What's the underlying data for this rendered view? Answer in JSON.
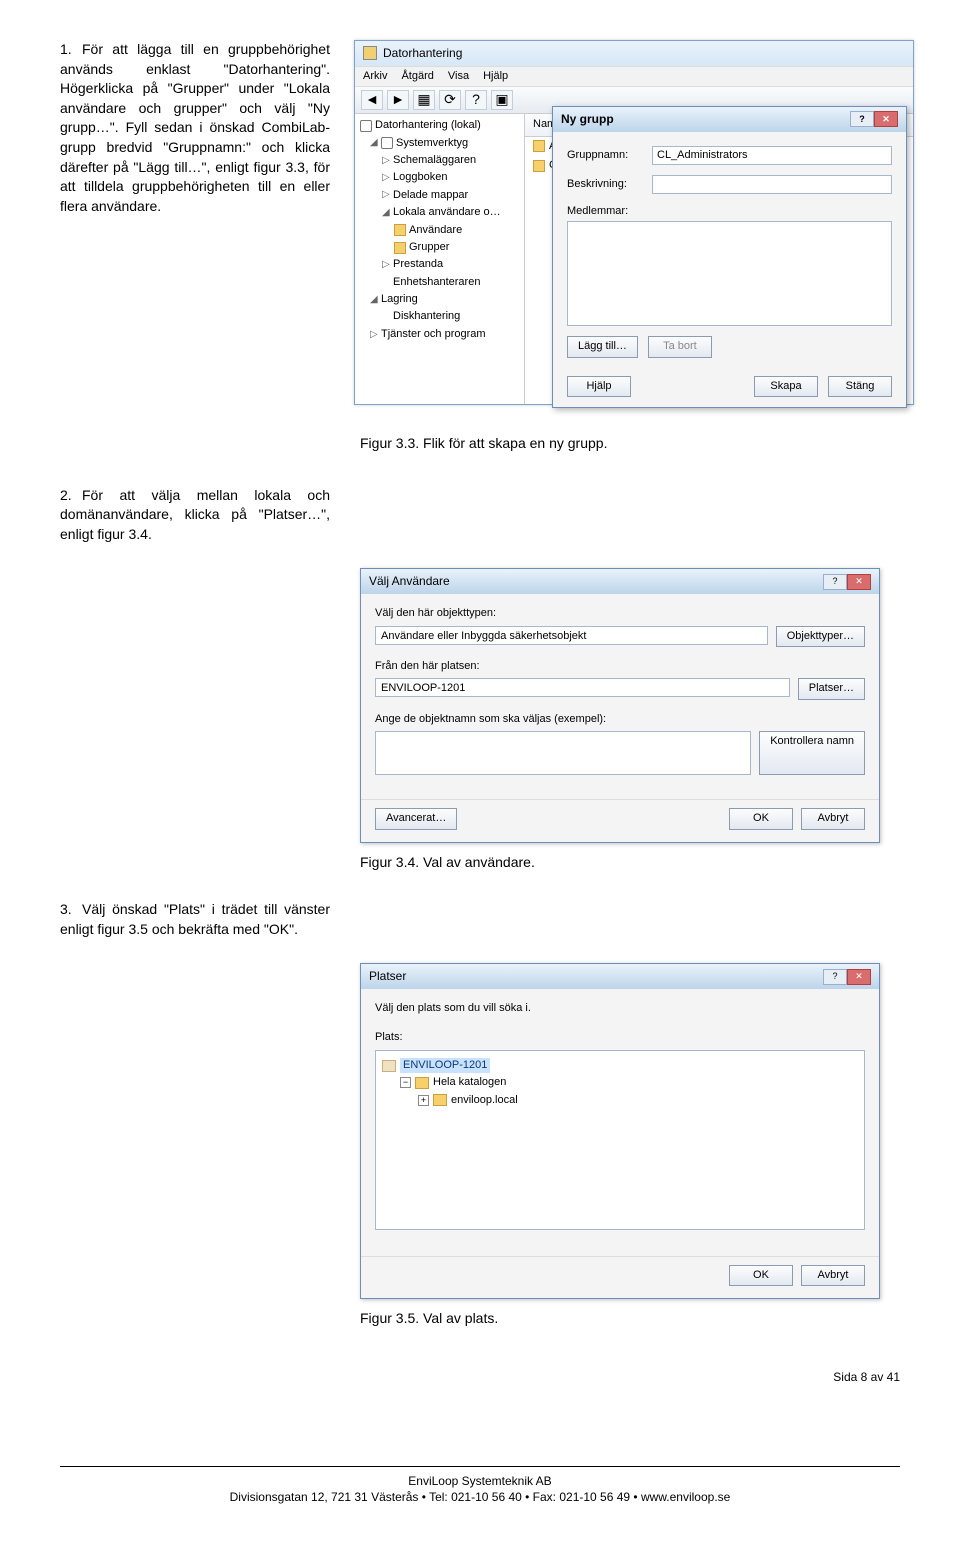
{
  "steps": {
    "s1": {
      "num": "1.",
      "text": "För att lägga till en gruppbehörighet används enklast \"Datorhantering\". Högerklicka på \"Grupper\" under \"Lokala användare och grupper\" och välj \"Ny grupp…\". Fyll sedan i önskad CombiLab-grupp bredvid \"Gruppnamn:\" och klicka därefter på \"Lägg till…\", enligt figur 3.3, för att tilldela gruppbehörigheten till en eller flera användare."
    },
    "s2": {
      "num": "2.",
      "text": "För att välja mellan lokala och domänanvändare, klicka på \"Platser…\", enligt figur 3.4."
    },
    "s3": {
      "num": "3.",
      "text": "Välj önskad \"Plats\" i trädet till vänster enligt figur 3.5 och bekräfta med \"OK\"."
    }
  },
  "fig33": {
    "window_title": "Datorhantering",
    "menu": {
      "m1": "Arkiv",
      "m2": "Åtgärd",
      "m3": "Visa",
      "m4": "Hjälp"
    },
    "tree": {
      "root": "Datorhantering (lokal)",
      "systemverktyg": "Systemverktyg",
      "schemalaggaren": "Schemaläggaren",
      "loggboken": "Loggboken",
      "delade": "Delade mappar",
      "lokala": "Lokala användare o…",
      "anvandare": "Användare",
      "grupper": "Grupper",
      "prestanda": "Prestanda",
      "enhet": "Enhetshanteraren",
      "lagring": "Lagring",
      "disk": "Diskhantering",
      "tjanster": "Tjänster och program"
    },
    "list_header": "Namn",
    "list_anv": "Användare",
    "list_grp": "Grupper",
    "dialog": {
      "title": "Ny grupp",
      "gruppnamn_lbl": "Gruppnamn:",
      "gruppnamn_val": "CL_Administrators",
      "beskr_lbl": "Beskrivning:",
      "medl_lbl": "Medlemmar:",
      "lagg": "Lägg till…",
      "tabort": "Ta bort",
      "hjalp": "Hjälp",
      "skapa": "Skapa",
      "stang": "Stäng"
    },
    "caption": "Figur 3.3. Flik för att skapa en ny grupp."
  },
  "fig34": {
    "title": "Välj Användare",
    "obj_lbl": "Välj den här objekttypen:",
    "obj_val": "Användare eller Inbyggda säkerhetsobjekt",
    "obj_btn": "Objekttyper…",
    "from_lbl": "Från den här platsen:",
    "from_val": "ENVILOOP-1201",
    "from_btn": "Platser…",
    "names_lbl": "Ange de objektnamn som ska väljas (exempel):",
    "names_btn": "Kontrollera namn",
    "avancerat": "Avancerat…",
    "ok": "OK",
    "avbryt": "Avbryt",
    "caption": "Figur 3.4. Val av användare."
  },
  "fig35": {
    "title": "Platser",
    "prompt": "Välj den plats som du vill söka i.",
    "plats_lbl": "Plats:",
    "n1": "ENVILOOP-1201",
    "n2": "Hela katalogen",
    "n3": "enviloop.local",
    "ok": "OK",
    "avbryt": "Avbryt",
    "caption": "Figur 3.5. Val av plats."
  },
  "footer": {
    "side": "Sida 8 av 41",
    "line1": "EnviLoop Systemteknik AB",
    "line2": "Divisionsgatan 12, 721 31 Västerås • Tel: 021-10 56 40 • Fax: 021-10 56 49 • www.enviloop.se"
  }
}
